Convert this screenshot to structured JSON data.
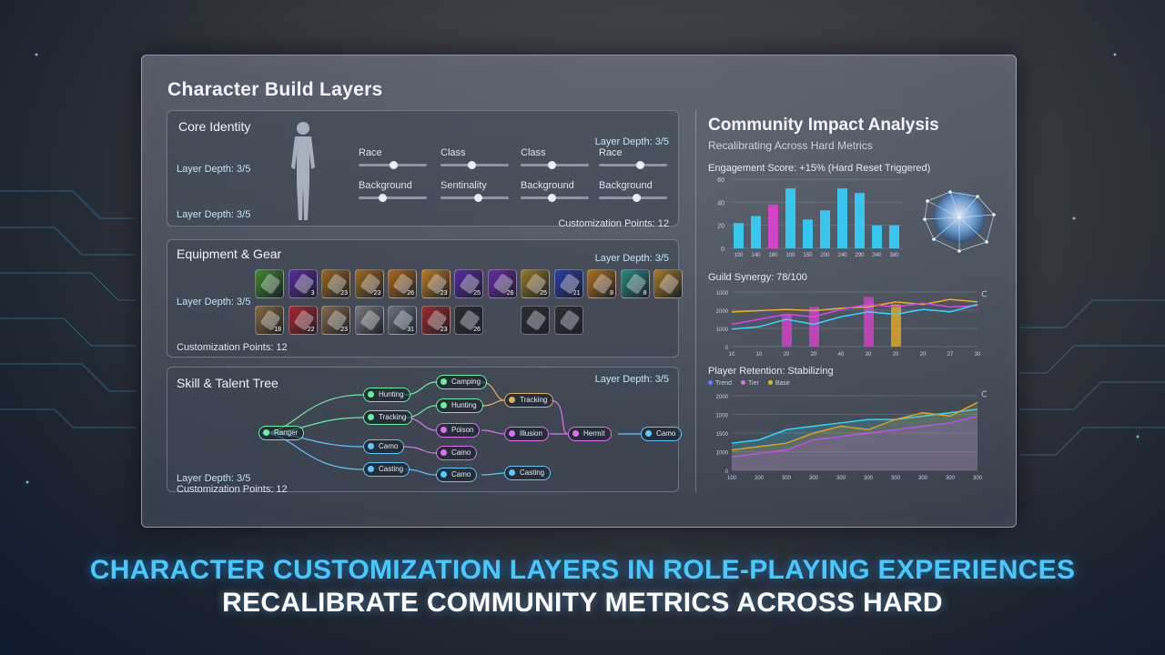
{
  "panel": {
    "title": "Character Build Layers"
  },
  "core": {
    "title": "Core Identity",
    "depth_top": "Layer Depth: 3/5",
    "depth_mid": "Layer Depth: 3/5",
    "depth_bottom": "Layer Depth: 3/5",
    "points": "Customization Points: 12",
    "sliders": [
      {
        "label": "Race",
        "value": 0.5
      },
      {
        "label": "Class",
        "value": 0.45
      },
      {
        "label": "Class",
        "value": 0.45
      },
      {
        "label": "Race",
        "value": 0.6
      },
      {
        "label": "Background",
        "value": 0.35
      },
      {
        "label": "Sentinality",
        "value": 0.55
      },
      {
        "label": "Background",
        "value": 0.45
      },
      {
        "label": "Background",
        "value": 0.55
      }
    ]
  },
  "gear": {
    "title": "Equipment & Gear",
    "depth_top": "Layer Depth: 3/5",
    "depth_left": "Layer Depth: 3/5",
    "points": "Customization Points: 12",
    "row1": [
      {
        "badge": "",
        "color": "#3e8b2c"
      },
      {
        "badge": "3",
        "color": "#5b2aa0"
      },
      {
        "badge": "23",
        "color": "#9a6a20"
      },
      {
        "badge": "23",
        "color": "#a06b1f"
      },
      {
        "badge": "26",
        "color": "#b36a1a"
      },
      {
        "badge": "23",
        "color": "#c07a22"
      },
      {
        "badge": "25",
        "color": "#5a2aa2"
      },
      {
        "badge": "26",
        "color": "#6b2aa8"
      },
      {
        "badge": "25",
        "color": "#9a7a20"
      },
      {
        "badge": "21",
        "color": "#2a3fa8"
      },
      {
        "badge": "8",
        "color": "#b0701a"
      },
      {
        "badge": "8",
        "color": "#2a8a80"
      },
      {
        "badge": "",
        "color": "#a87a20"
      }
    ],
    "row2": [
      {
        "badge": "18",
        "color": "#8a6a3a"
      },
      {
        "badge": "22",
        "color": "#b0262a"
      },
      {
        "badge": "23",
        "color": "#8a6a4a"
      },
      {
        "badge": "",
        "color": "#7a7a80"
      },
      {
        "badge": "31",
        "color": "#6a7480"
      },
      {
        "badge": "23",
        "color": "#a02a2a"
      },
      {
        "badge": "26",
        "color": "#2a2e36"
      }
    ],
    "row3": [
      {
        "badge": "",
        "color": "#2a2e36"
      },
      {
        "badge": "",
        "color": "#2a2e36"
      }
    ]
  },
  "skills": {
    "title": "Skill & Talent Tree",
    "depth_top": "Layer Depth: 3/5",
    "depth_bottom": "Layer Depth: 3/5",
    "points": "Customization Points: 12",
    "nodes": [
      {
        "label": "Ranger",
        "color": "#6cf0a0"
      },
      {
        "label": "Hunting",
        "color": "#6cf0a0"
      },
      {
        "label": "Tracking",
        "color": "#6cf0a0"
      },
      {
        "label": "Camping",
        "color": "#6cf0a0"
      },
      {
        "label": "Hunting",
        "color": "#6cf0a0"
      },
      {
        "label": "Tracking",
        "color": "#e0b060"
      },
      {
        "label": "Poison",
        "color": "#e070f0"
      },
      {
        "label": "Illusion",
        "color": "#e070f0"
      },
      {
        "label": "Hermit",
        "color": "#e070f0"
      },
      {
        "label": "Camo",
        "color": "#5ec8ff"
      },
      {
        "label": "Camo",
        "color": "#e070f0"
      },
      {
        "label": "Casting",
        "color": "#5ec8ff"
      },
      {
        "label": "Camo",
        "color": "#5ec8ff"
      },
      {
        "label": "Casting",
        "color": "#5ec8ff"
      },
      {
        "label": "Camo",
        "color": "#5ec8ff"
      }
    ]
  },
  "community": {
    "title": "Community Impact Analysis",
    "subtitle": "Recalibrating Across Hard Metrics",
    "engagement_label": "Engagement Score: +15% (Hard Reset Triggered)",
    "synergy_label": "Guild Synergy: 78/100",
    "retention_label": "Player Retention: Stabilizing",
    "legend": [
      "Trend",
      "Tier",
      "Base"
    ]
  },
  "chart_data": [
    {
      "type": "bar",
      "title": "Engagement Score: +15% (Hard Reset Triggered)",
      "categories": [
        "100",
        "140",
        "180",
        "100",
        "150",
        "200",
        "240",
        "290",
        "340",
        "380"
      ],
      "values": [
        22,
        28,
        38,
        52,
        25,
        33,
        52,
        48,
        20,
        20
      ],
      "ylim": [
        0,
        60
      ],
      "yticks": [
        "0",
        "20",
        "40",
        "60"
      ],
      "colors": [
        "#35d0ff",
        "#35d0ff",
        "#e040d0",
        "#35d0ff",
        "#35d0ff",
        "#35d0ff",
        "#35d0ff",
        "#35d0ff",
        "#35d0ff",
        "#35d0ff"
      ]
    },
    {
      "type": "line",
      "title": "Guild Synergy: 78/100",
      "yticks": [
        "1000",
        "2000",
        "1000",
        "0"
      ],
      "xticks": [
        "10",
        "10",
        "20",
        "20",
        "40",
        "30",
        "20",
        "20",
        "27",
        "30"
      ],
      "series": [
        {
          "values": [
            1400,
            1450,
            1500,
            1450,
            1550,
            1600,
            1800,
            1700,
            1900,
            1800
          ]
        },
        {
          "values": [
            900,
            1100,
            1300,
            1200,
            1500,
            1700,
            1600,
            1750,
            1600,
            1650
          ]
        },
        {
          "values": [
            700,
            800,
            1100,
            900,
            1200,
            1400,
            1300,
            1500,
            1400,
            1700
          ]
        }
      ],
      "bars": [
        1300,
        1600,
        2000,
        1700
      ]
    },
    {
      "type": "area",
      "title": "Player Retention: Stabilizing",
      "yticks": [
        "2000",
        "1000",
        "1500",
        "1000",
        "0"
      ],
      "xticks": [
        "100",
        "200",
        "300",
        "300",
        "300",
        "300",
        "300",
        "300",
        "300",
        "300"
      ],
      "series": [
        {
          "values": [
            800,
            900,
            1200,
            1300,
            1400,
            1500,
            1500,
            1600,
            1700,
            1800
          ]
        },
        {
          "values": [
            600,
            700,
            800,
            1100,
            1300,
            1200,
            1500,
            1700,
            1600,
            2000
          ]
        },
        {
          "values": [
            400,
            500,
            600,
            900,
            1000,
            1100,
            1200,
            1300,
            1400,
            1600
          ]
        }
      ],
      "colors": [
        "#30d8ff",
        "#e0a020",
        "#c050f0"
      ]
    }
  ],
  "captions": {
    "line1": "CHARACTER CUSTOMIZATION LAYERS IN ROLE-PLAYING EXPERIENCES",
    "line2": "RECALIBRATE COMMUNITY METRICS ACROSS HARD"
  }
}
